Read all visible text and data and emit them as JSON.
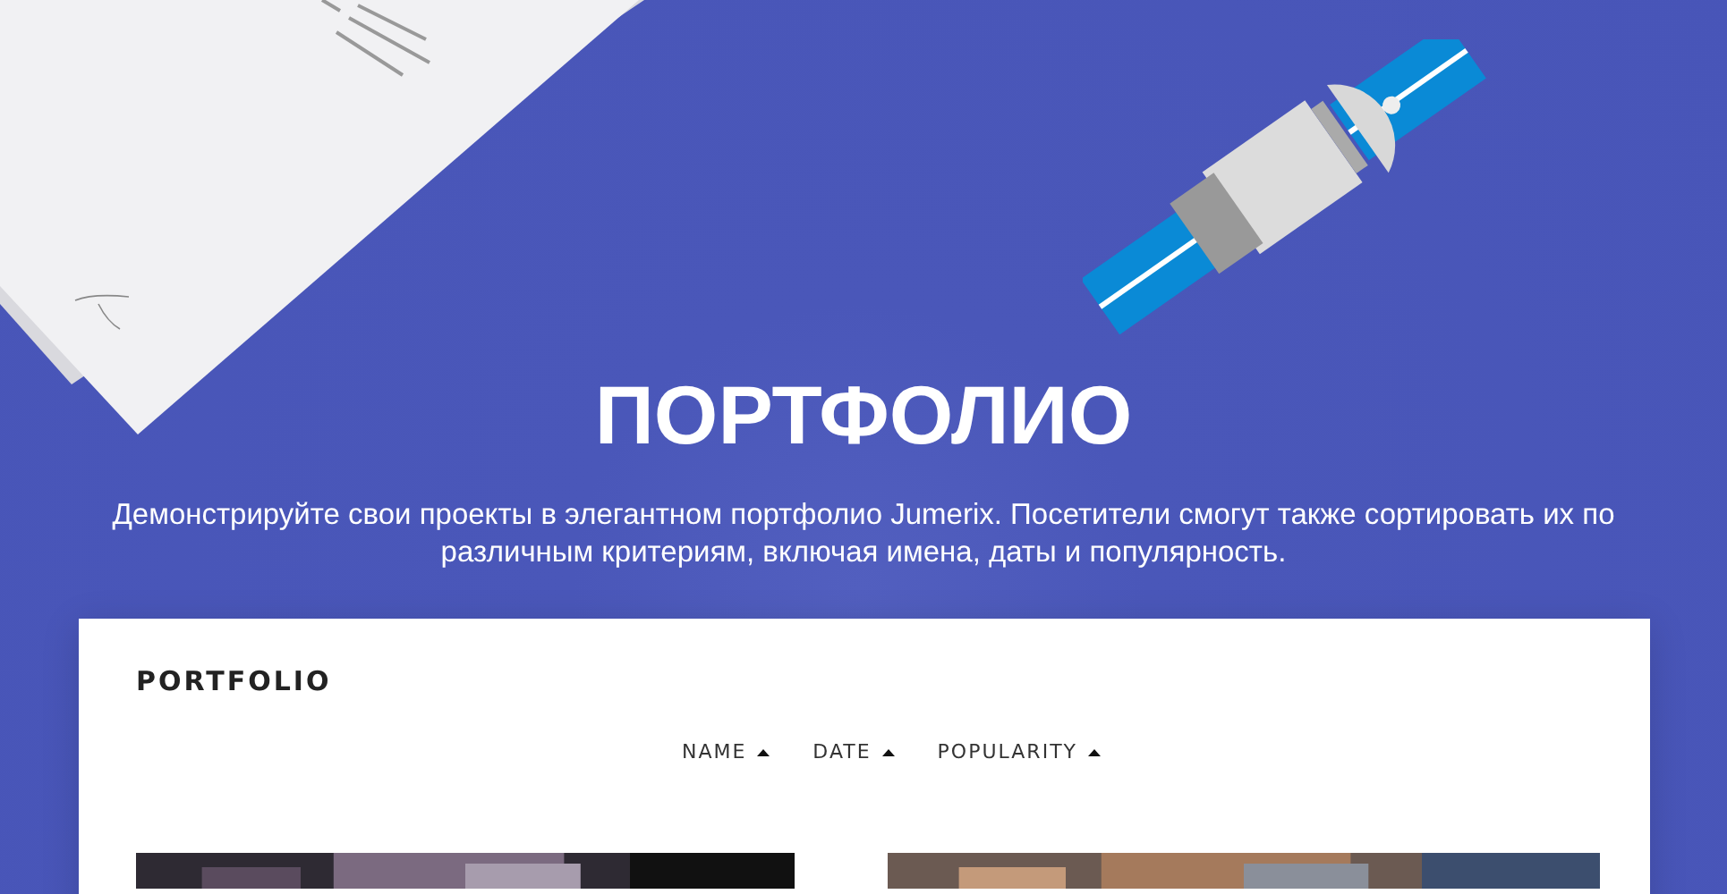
{
  "hero": {
    "title": "ПОРТФОЛИО",
    "description": "Демонстрируйте свои проекты в элегантном портфолио Jumerix. Посетители смогут также сортировать их по различным критериям, включая имена, даты и популярность."
  },
  "portfolio": {
    "heading": "PORTFOLIO",
    "sort_options": [
      {
        "label": "NAME"
      },
      {
        "label": "DATE"
      },
      {
        "label": "POPULARITY"
      }
    ]
  }
}
